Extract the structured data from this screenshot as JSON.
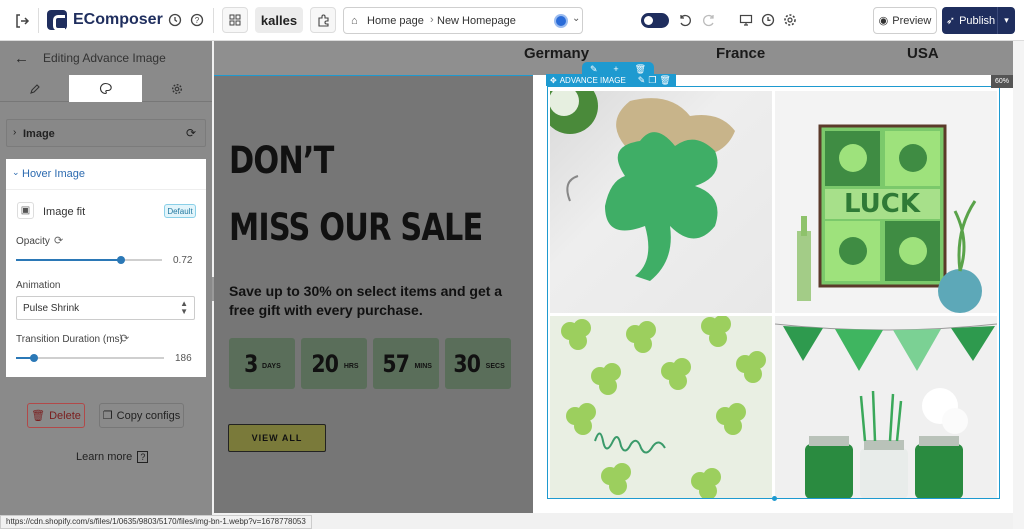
{
  "header": {
    "brand": "EComposer",
    "store": "kalles",
    "breadcrumb": [
      "Home page",
      "New Homepage"
    ],
    "preview_label": "Preview",
    "publish_label": "Publish"
  },
  "sidebar": {
    "title": "Editing Advance Image",
    "sections": {
      "image": "Image",
      "hover": "Hover Image"
    },
    "image_fit": {
      "label": "Image fit",
      "badge": "Default"
    },
    "opacity": {
      "label": "Opacity",
      "value": "0.72",
      "fraction": 0.72
    },
    "animation": {
      "label": "Animation",
      "value": "Pulse Shrink"
    },
    "transition": {
      "label": "Transition Duration (ms)",
      "value": "186",
      "fraction": 0.12
    },
    "delete_label": "Delete",
    "copy_label": "Copy configs",
    "learn_more": "Learn more"
  },
  "canvas": {
    "countries": [
      "Germany",
      "France",
      "USA"
    ],
    "headline_1": "DON’T",
    "headline_2": "MISS OUR SALE",
    "subcopy": "Save up to 30% on select items and get a free gift with every purchase.",
    "countdown": [
      {
        "num": "3",
        "unit": "DAYS"
      },
      {
        "num": "20",
        "unit": "HRS"
      },
      {
        "num": "57",
        "unit": "MINS"
      },
      {
        "num": "30",
        "unit": "SECS"
      }
    ],
    "cta": "VIEW ALL",
    "element_label": "ADVANCE IMAGE",
    "zoom": "60%"
  },
  "status_url": "https://cdn.shopify.com/s/files/1/0635/9803/5170/files/img-bn-1.webp?v=1678778053",
  "colors": {
    "brand": "#1f2e5e",
    "accent": "#1e9ad0",
    "slider": "#2b78b6",
    "delete": "#b24949"
  }
}
